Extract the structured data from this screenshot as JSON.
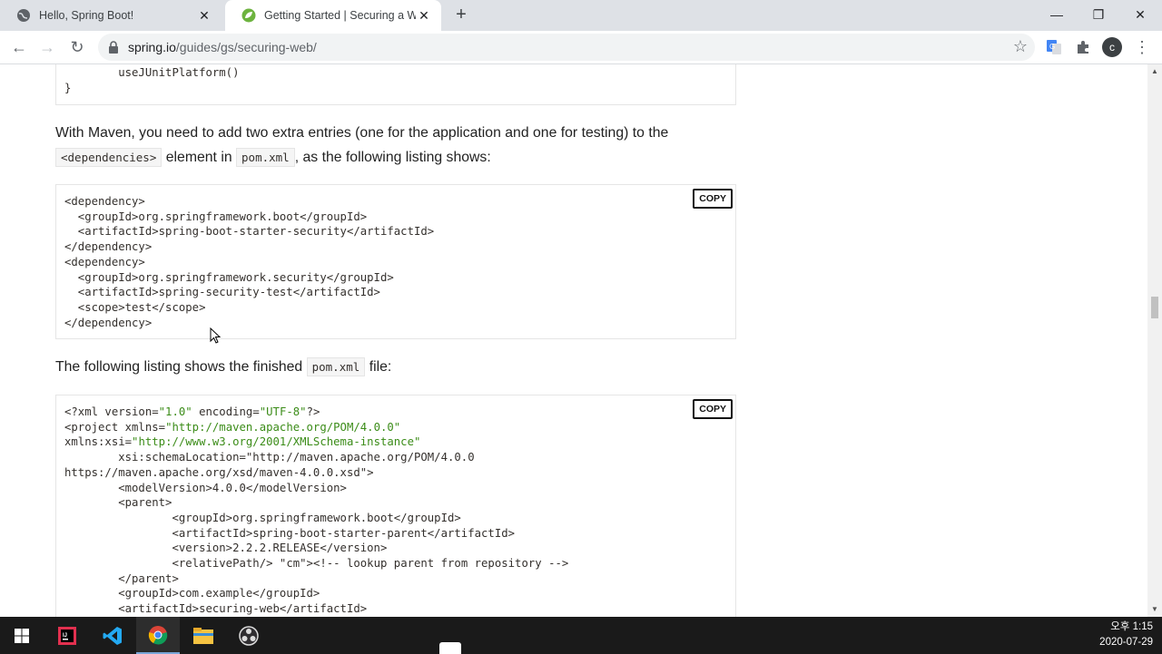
{
  "browser": {
    "tabs": [
      {
        "title": "Hello, Spring Boot!",
        "icon": "globe-icon",
        "active": false
      },
      {
        "title": "Getting Started | Securing a Web",
        "icon": "spring-leaf-icon",
        "active": true
      }
    ],
    "url_host": "spring.io",
    "url_path": "/guides/gs/securing-web/",
    "avatar_letter": "c"
  },
  "page": {
    "top_code": [
      "        useJUnitPlatform()",
      "}"
    ],
    "maven_para_1": "With Maven, you need to add two extra entries (one for the application and one for testing) to the",
    "maven_inline_1": "<dependencies>",
    "maven_para_2": "element in",
    "maven_inline_2": "pom.xml",
    "maven_para_3": ", as the following listing shows:",
    "copy_label": "COPY",
    "deps_code": [
      "<dependency>",
      "  <groupId>org.springframework.boot</groupId>",
      "  <artifactId>spring-boot-starter-security</artifactId>",
      "</dependency>",
      "<dependency>",
      "  <groupId>org.springframework.security</groupId>",
      "  <artifactId>spring-security-test</artifactId>",
      "  <scope>test</scope>",
      "</dependency>"
    ],
    "finished_para_1": "The following listing shows the finished",
    "finished_inline": "pom.xml",
    "finished_para_2": "file:",
    "pom_code": [
      "<?xml version=\"1.0\" encoding=\"UTF-8\"?>",
      "<project xmlns=\"http://maven.apache.org/POM/4.0.0\"",
      "xmlns:xsi=\"http://www.w3.org/2001/XMLSchema-instance\"",
      "        xsi:schemaLocation=\"http://maven.apache.org/POM/4.0.0",
      "https://maven.apache.org/xsd/maven-4.0.0.xsd\">",
      "        <modelVersion>4.0.0</modelVersion>",
      "        <parent>",
      "                <groupId>org.springframework.boot</groupId>",
      "                <artifactId>spring-boot-starter-parent</artifactId>",
      "                <version>2.2.2.RELEASE</version>",
      "                <relativePath/> <!-- lookup parent from repository -->",
      "        </parent>",
      "        <groupId>com.example</groupId>",
      "        <artifactId>securing-web</artifactId>"
    ]
  },
  "taskbar": {
    "apps": [
      "windows-start-icon",
      "intellij-icon",
      "vscode-icon",
      "chrome-icon",
      "file-explorer-icon",
      "obs-icon"
    ],
    "time": "오후 1:15",
    "date": "2020-07-29"
  }
}
